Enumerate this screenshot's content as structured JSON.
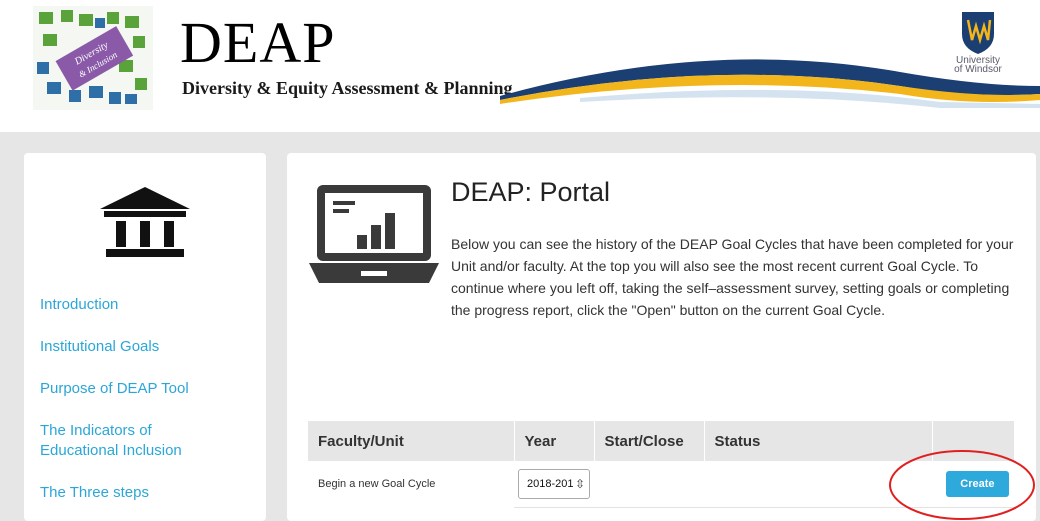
{
  "header": {
    "title": "DEAP",
    "subtitle": "Diversity & Equity Assessment & Planning",
    "logo_text_1": "Diversity",
    "logo_text_2": "& Inclusion",
    "university_line_1": "University",
    "university_line_2": "of Windsor"
  },
  "sidebar": {
    "icon": "institution-icon",
    "items": [
      {
        "label": "Introduction"
      },
      {
        "label": "Institutional Goals"
      },
      {
        "label": "Purpose of DEAP Tool"
      },
      {
        "label": "The Indicators of Educational Inclusion"
      },
      {
        "label": "The Three steps"
      }
    ]
  },
  "main": {
    "icon": "laptop-chart-icon",
    "title": "DEAP: Portal",
    "description": "Below you can see the history of the DEAP Goal Cycles that have been completed for your Unit and/or faculty. At the top you will also see the most recent current Goal Cycle. To continue where you left off, taking the self–assessment survey, setting goals or completing the progress report, click the \"Open\" button on the current Goal Cycle.",
    "table": {
      "headers": [
        "Faculty/Unit",
        "Year",
        "Start/Close",
        "Status",
        ""
      ],
      "new_row": {
        "label": "Begin a new Goal Cycle",
        "year_value": "2018-201",
        "create_label": "Create"
      }
    }
  },
  "colors": {
    "accent": "#2ea9dc",
    "link": "#2aa7d8",
    "annotation": "#e02020"
  }
}
